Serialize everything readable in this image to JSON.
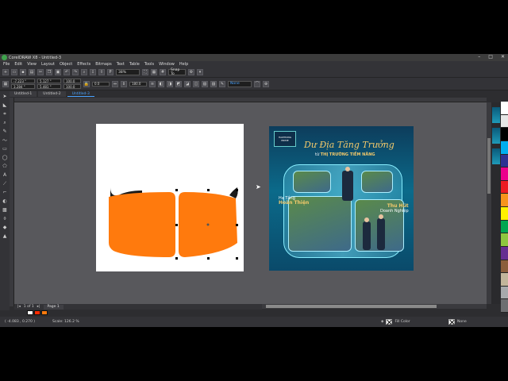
{
  "app": {
    "title": "CorelDRAW X8 - Untitled-3",
    "window_controls": [
      "–",
      "□",
      "✕"
    ]
  },
  "menu": [
    "File",
    "Edit",
    "View",
    "Layout",
    "Object",
    "Effects",
    "Bitmaps",
    "Text",
    "Table",
    "Tools",
    "Window",
    "Help"
  ],
  "toolbar": {
    "zoom": "38%",
    "snap_to": "Snap To",
    "outline": "None"
  },
  "propbar": {
    "x": "-7.223 \"",
    "y": "3.284 \"",
    "width": "5.127 \"",
    "height": "5.481 \"",
    "scale_w": "100.0",
    "scale_h": "100.0",
    "rotation": "0.0",
    "angle": "180.0"
  },
  "tabs": [
    "Untitled-1",
    "Untitled-2",
    "Untitled-3"
  ],
  "design": {
    "brand": "HAIPHONG PRIME",
    "headline": "Dư Địa Tăng Trưởng",
    "sub_prefix": "từ",
    "sub_emph": "THỊ TRƯỜNG TIỀM NĂNG",
    "panel_left_small": "Hạ Tầng",
    "panel_left_big": "Hoàn Thiện",
    "panel_right_big": "Thu Hút",
    "panel_right_small": "Doanh Nghiệp"
  },
  "shape_colors": {
    "orange": "#ff7a0d",
    "dark": "#1b1b1b",
    "accent": "#4aa3ff"
  },
  "page_nav": {
    "position": "1 of 1",
    "page_tab": "Page 1"
  },
  "status": {
    "coords": "( -4.083 , 0.270 )",
    "scale": "Scale: 126.2 %",
    "fill": "Fill Color",
    "outline": "None"
  }
}
